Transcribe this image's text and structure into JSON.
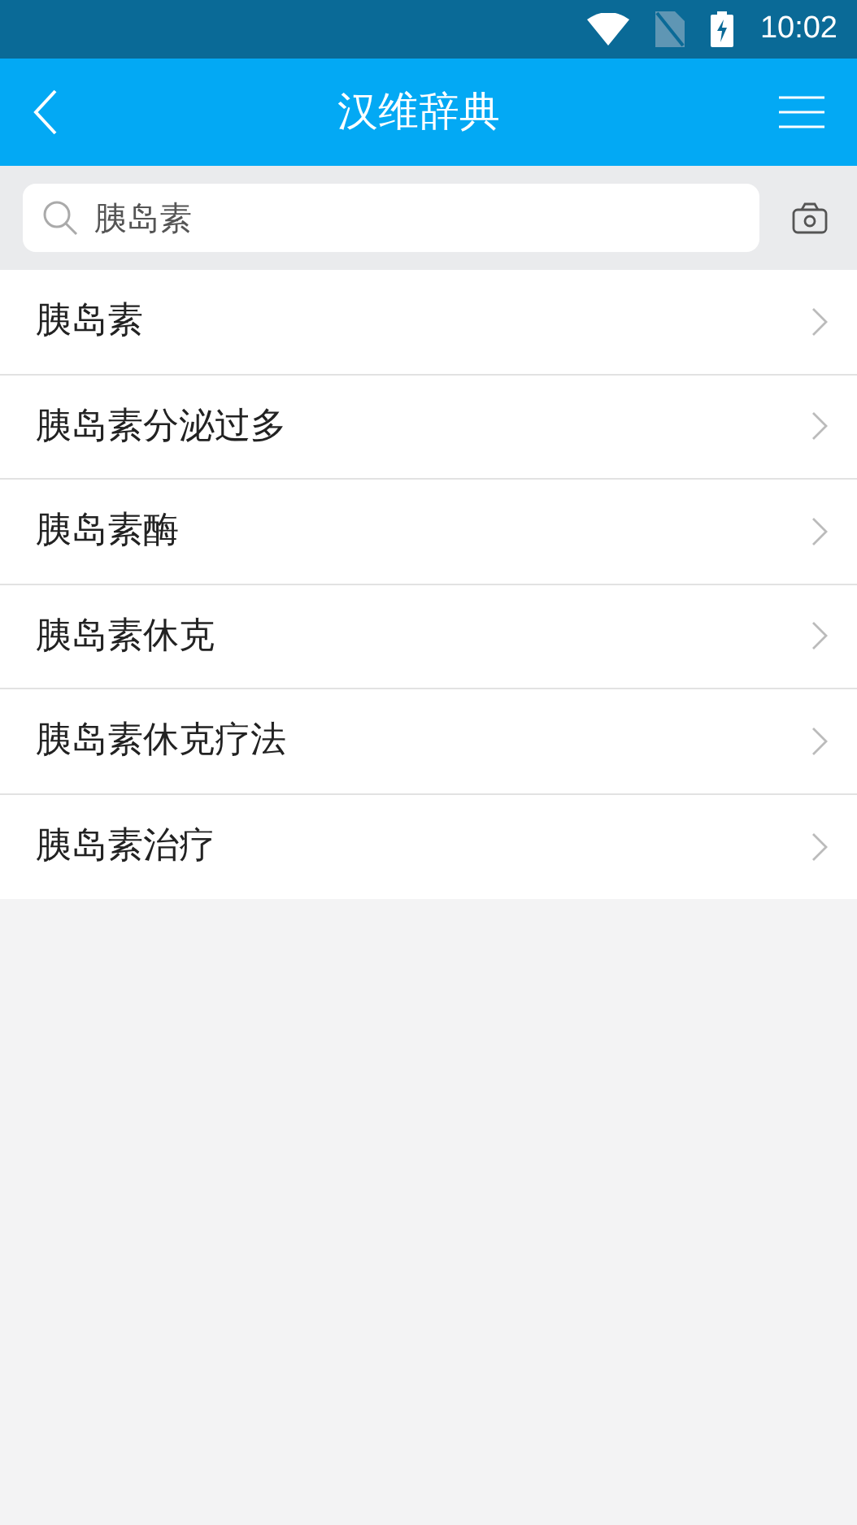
{
  "status_bar": {
    "time": "10:02"
  },
  "header": {
    "title": "汉维辞典"
  },
  "search": {
    "value": "胰岛素"
  },
  "results": [
    {
      "label": "胰岛素"
    },
    {
      "label": "胰岛素分泌过多"
    },
    {
      "label": "胰岛素酶"
    },
    {
      "label": "胰岛素休克"
    },
    {
      "label": "胰岛素休克疗法"
    },
    {
      "label": "胰岛素治疗"
    }
  ]
}
